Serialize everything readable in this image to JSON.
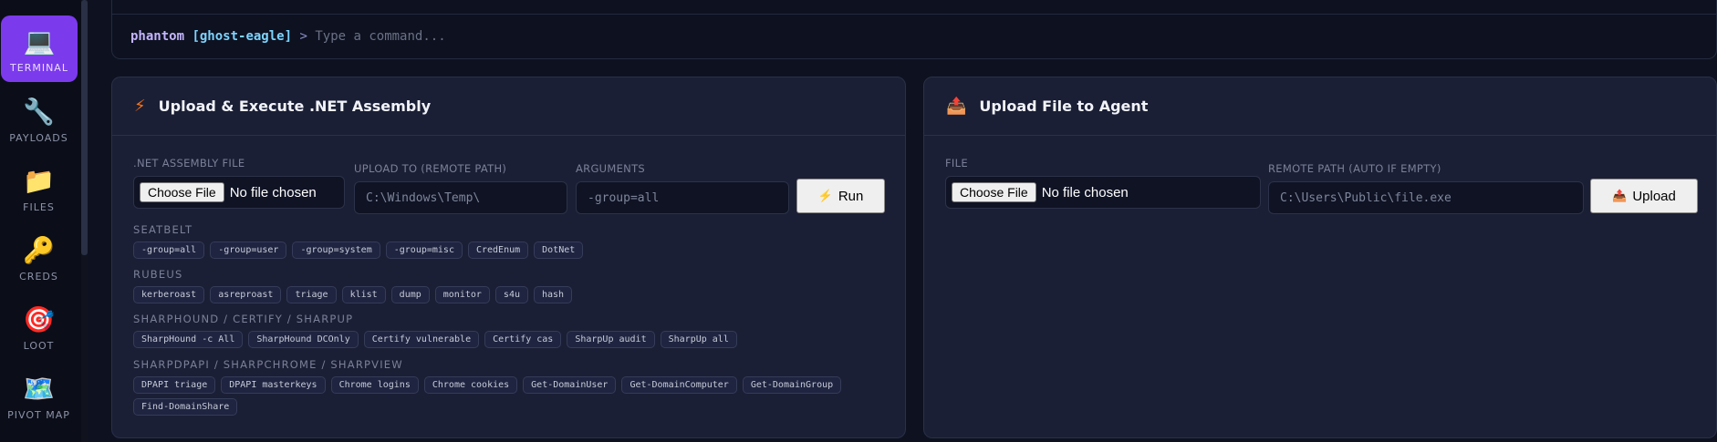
{
  "sidebar": {
    "items": [
      {
        "label": "TERMINAL",
        "icon": "💻"
      },
      {
        "label": "PAYLOADS",
        "icon": "🔧"
      },
      {
        "label": "FILES",
        "icon": "📁"
      },
      {
        "label": "CREDS",
        "icon": "🔑"
      },
      {
        "label": "LOOT",
        "icon": "🎯"
      },
      {
        "label": "PIVOT MAP",
        "icon": "🗺️"
      }
    ]
  },
  "terminal": {
    "user": "phantom",
    "host": "[ghost-eagle]",
    "arrow": ">",
    "placeholder": "Type a command..."
  },
  "assembly": {
    "icon": "⚡",
    "title": "Upload & Execute .NET Assembly",
    "file_label": ".NET ASSEMBLY FILE",
    "choose_label": "Choose File",
    "no_file": "No file chosen",
    "upload_label": "UPLOAD TO (REMOTE PATH)",
    "upload_placeholder": "C:\\Windows\\Temp\\",
    "args_label": "ARGUMENTS",
    "args_placeholder": "-group=all",
    "run_icon": "⚡",
    "run_label": "Run",
    "sections": [
      {
        "title": "SEATBELT",
        "chips": [
          "-group=all",
          "-group=user",
          "-group=system",
          "-group=misc",
          "CredEnum",
          "DotNet"
        ]
      },
      {
        "title": "RUBEUS",
        "chips": [
          "kerberoast",
          "asreproast",
          "triage",
          "klist",
          "dump",
          "monitor",
          "s4u",
          "hash"
        ]
      },
      {
        "title": "SHARPHOUND / CERTIFY / SHARPUP",
        "chips": [
          "SharpHound -c All",
          "SharpHound DCOnly",
          "Certify vulnerable",
          "Certify cas",
          "SharpUp audit",
          "SharpUp all"
        ]
      },
      {
        "title": "SHARPDPAPI / SHARPCHROME / SHARPVIEW",
        "chips": [
          "DPAPI triage",
          "DPAPI masterkeys",
          "Chrome logins",
          "Chrome cookies",
          "Get-DomainUser",
          "Get-DomainComputer",
          "Get-DomainGroup",
          "Find-DomainShare"
        ]
      }
    ]
  },
  "upload": {
    "icon": "📤",
    "title": "Upload File to Agent",
    "file_label": "FILE",
    "choose_label": "Choose File",
    "no_file": "No file chosen",
    "remote_label": "REMOTE PATH (AUTO IF EMPTY)",
    "remote_placeholder": "C:\\Users\\Public\\file.exe",
    "upload_icon": "📤",
    "upload_label": "Upload"
  }
}
